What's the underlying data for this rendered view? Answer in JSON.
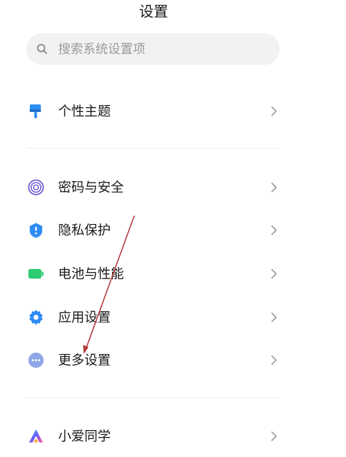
{
  "header": {
    "title": "设置"
  },
  "search": {
    "placeholder": "搜索系统设置项"
  },
  "items": [
    {
      "label": "个性主题",
      "icon": "paint-brush-icon",
      "color": "#2f8cf3"
    },
    {
      "label": "密码与安全",
      "icon": "fingerprint-icon",
      "color": "#6a5bd6"
    },
    {
      "label": "隐私保护",
      "icon": "shield-icon",
      "color": "#2f8cf3"
    },
    {
      "label": "电池与性能",
      "icon": "battery-icon",
      "color": "#2ecc71"
    },
    {
      "label": "应用设置",
      "icon": "gear-icon",
      "color": "#2f8cf3"
    },
    {
      "label": "更多设置",
      "icon": "more-dots-icon",
      "color": "#8fa6e8"
    },
    {
      "label": "小爱同学",
      "icon": "xiaoai-icon",
      "color": "#4b7bf5"
    }
  ],
  "colors": {
    "chevron": "#9e9e9e",
    "annotation_arrow": "#b23a3a"
  }
}
